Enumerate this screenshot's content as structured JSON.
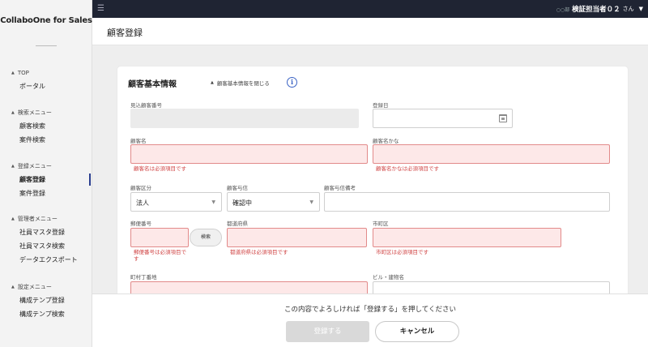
{
  "sidebar": {
    "brand": "CollaboOne for Sales",
    "sections": [
      {
        "head": "TOP",
        "items": [
          {
            "label": "ポータル"
          }
        ]
      },
      {
        "head": "検索メニュー",
        "items": [
          {
            "label": "顧客検索"
          },
          {
            "label": "案件検索"
          }
        ]
      },
      {
        "head": "登録メニュー",
        "items": [
          {
            "label": "顧客登録"
          },
          {
            "label": "案件登録"
          }
        ]
      },
      {
        "head": "管理者メニュー",
        "items": [
          {
            "label": "社員マスタ登録"
          },
          {
            "label": "社員マスタ検索"
          },
          {
            "label": "データエクスポート"
          }
        ]
      },
      {
        "head": "設定メニュー",
        "items": [
          {
            "label": "構成テンプ登録"
          },
          {
            "label": "構成テンプ検索"
          }
        ]
      }
    ],
    "active_item": "顧客登録"
  },
  "topbar": {
    "menu_icon": "menu-collapse-icon",
    "user_dept": "○○部",
    "user_name": "検証担当者０２",
    "user_suffix": "さん",
    "caret_icon": "caret-down-icon"
  },
  "page": {
    "title": "顧客登録"
  },
  "form": {
    "title": "顧客基本情報",
    "collapse_label": "顧客基本情報を閉じる",
    "info_icon": "info-icon",
    "fields": {
      "prospect_no": {
        "label": "見込顧客番号",
        "value": ""
      },
      "register_date": {
        "label": "登録日",
        "value": ""
      },
      "customer_name": {
        "label": "顧客名",
        "value": "",
        "error": "顧客名は必須項目です"
      },
      "customer_kana": {
        "label": "顧客名かな",
        "value": "",
        "error": "顧客名かなは必須項目です"
      },
      "customer_type": {
        "label": "顧客区分",
        "value": "法人"
      },
      "credit": {
        "label": "顧客与信",
        "value": "確認中"
      },
      "credit_note": {
        "label": "顧客与信備考",
        "value": ""
      },
      "postal_code": {
        "label": "郵便番号",
        "value": "",
        "error": "郵便番号は必須項目です"
      },
      "postal_search_label": "検索",
      "prefecture": {
        "label": "都道府県",
        "value": "",
        "error": "都道府県は必須項目です"
      },
      "city": {
        "label": "市町区",
        "value": "",
        "error": "市町区は必須項目です"
      },
      "street": {
        "label": "町村丁番地",
        "value": ""
      },
      "building": {
        "label": "ビル・建物名",
        "value": ""
      }
    }
  },
  "footer": {
    "message": "この内容でよろしければ「登録する」を押してください",
    "register_label": "登録する",
    "cancel_label": "キャンセル"
  },
  "colors": {
    "topbar": "#1f2433",
    "error_fill": "#fde8e8",
    "error_border": "#e28a8a",
    "error_text": "#d04545",
    "active_indicator": "#2a3e8f",
    "info_accent": "#3b63c4"
  }
}
